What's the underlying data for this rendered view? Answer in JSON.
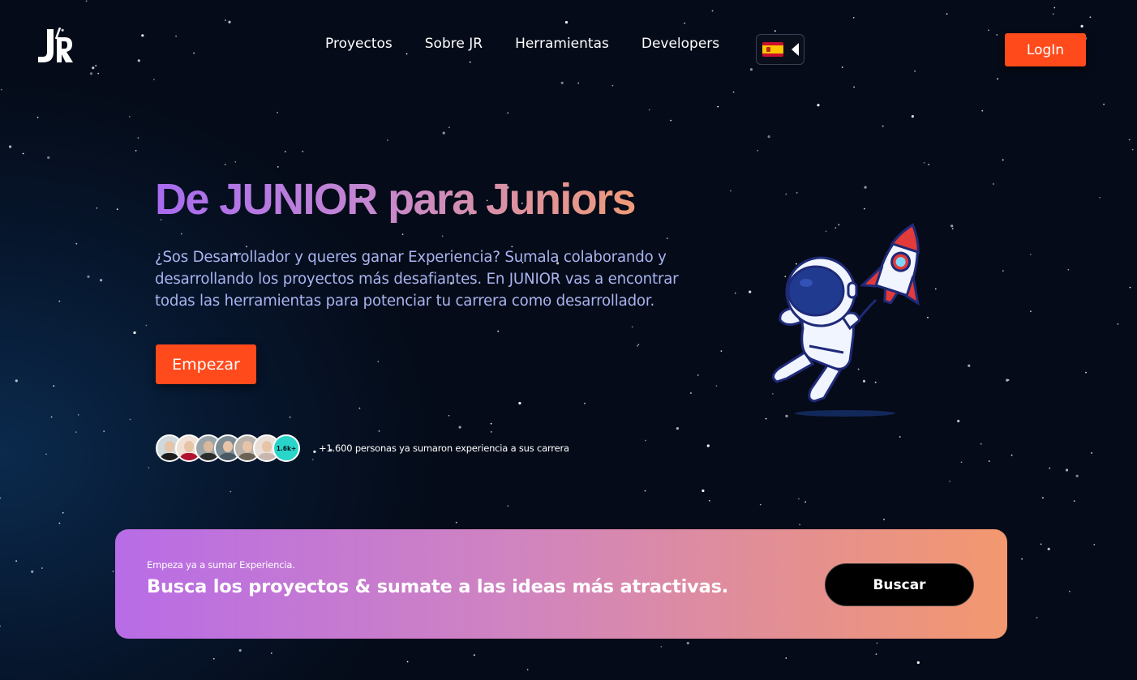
{
  "header": {
    "logo_icon": "jr-logo-icon",
    "nav": [
      "Proyectos",
      "Sobre JR",
      "Herramientas",
      "Developers"
    ],
    "language": {
      "flag_icon": "spain-flag-icon",
      "caret_icon": "caret-left-icon"
    },
    "login_label": "LogIn"
  },
  "hero": {
    "title": "De JUNIOR para Juniors",
    "subtitle": "¿Sos Desarrollador y queres ganar Experiencia? Sumala colaborando y desarrollando los proyectos más desafiantes. En JUNIOR vas a encontrar todas las herramientas para potenciar tu carrera como desarrollador.",
    "start_label": "Empezar",
    "avatars_count": "1.6k+",
    "social_text": "+1.600 personas ya sumaron experiencia a sus carrera",
    "illustration": "astronaut-rocket-icon"
  },
  "cta": {
    "kicker": "Empeza ya a sumar Experiencia.",
    "title": "Busca los proyectos & sumate a las ideas más atractivas.",
    "search_label": "Buscar"
  },
  "colors": {
    "accent": "#ff4a1c",
    "background": "#050b18",
    "gradient_start": "#a86bf0",
    "gradient_end": "#f3986e",
    "subtitle": "#a9b4f0"
  }
}
